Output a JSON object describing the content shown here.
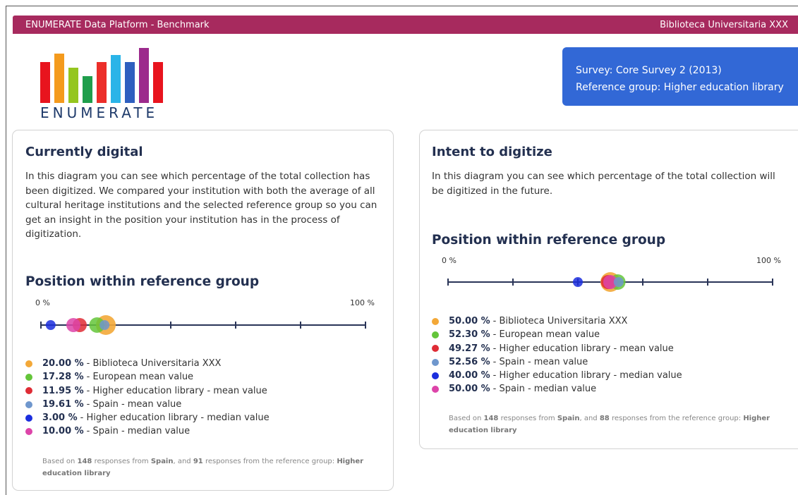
{
  "header": {
    "title": "ENUMERATE Data Platform - Benchmark",
    "institution": "Biblioteca Universitaria XXX"
  },
  "logo": {
    "text": "ENUMERATE",
    "bar_colors": [
      "#e8141e",
      "#f49a1d",
      "#95c61f",
      "#1f9e4c",
      "#ec2e29",
      "#2ab4e8",
      "#2e5fbf",
      "#9c2a8c",
      "#e8141e"
    ]
  },
  "survey": {
    "survey_line": "Survey: Core Survey 2 (2013)",
    "group_line": "Reference group: Higher education library"
  },
  "colors": {
    "institution": "#f3a838",
    "european": "#64c53a",
    "ref_mean": "#df2c35",
    "country_mean": "#6f97cd",
    "ref_median": "#1b2ede",
    "country_median": "#dd44a9"
  },
  "panels": [
    {
      "title": "Currently digital",
      "description": "In this diagram you can see which percentage of the total collection has been digitized. We compared your institution with both the average of all cultural heritage institutions and the selected reference group so you can get an insight in the position your institution has in the process of digitization.",
      "position_title": "Position within reference group",
      "axis_min_label": "0 %",
      "axis_max_label": "100 %",
      "legend": [
        {
          "value": "20.00 %",
          "label": " - Biblioteca Universitaria XXX",
          "pct": 20.0,
          "color_key": "institution"
        },
        {
          "value": "17.28 %",
          "label": " - European mean value",
          "pct": 17.28,
          "color_key": "european"
        },
        {
          "value": "11.95 %",
          "label": " - Higher education library - mean value",
          "pct": 11.95,
          "color_key": "ref_mean"
        },
        {
          "value": "19.61 %",
          "label": " - Spain - mean value",
          "pct": 19.61,
          "color_key": "country_mean"
        },
        {
          "value": "3.00 %",
          "label": " - Higher education library - median value",
          "pct": 3.0,
          "color_key": "ref_median"
        },
        {
          "value": "10.00 %",
          "label": " - Spain - median value",
          "pct": 10.0,
          "color_key": "country_median"
        }
      ],
      "note": {
        "p1": "Based on ",
        "responses": "148",
        "p2": " responses from ",
        "country": "Spain",
        "p3": ", and ",
        "ref_responses": "91",
        "p4": " responses from the reference group: ",
        "group": "Higher education library"
      }
    },
    {
      "title": "Intent to digitize",
      "description": "In this diagram you can see which percentage of the total collection will be digitized in the future.",
      "position_title": "Position within reference group",
      "axis_min_label": "0 %",
      "axis_max_label": "100 %",
      "legend": [
        {
          "value": "50.00 %",
          "label": " - Biblioteca Universitaria XXX",
          "pct": 50.0,
          "color_key": "institution"
        },
        {
          "value": "52.30 %",
          "label": " - European mean value",
          "pct": 52.3,
          "color_key": "european"
        },
        {
          "value": "49.27 %",
          "label": " - Higher education library - mean value",
          "pct": 49.27,
          "color_key": "ref_mean"
        },
        {
          "value": "52.56 %",
          "label": " - Spain - mean value",
          "pct": 52.56,
          "color_key": "country_mean"
        },
        {
          "value": "40.00 %",
          "label": " - Higher education library - median value",
          "pct": 40.0,
          "color_key": "ref_median"
        },
        {
          "value": "50.00 %",
          "label": " - Spain - median value",
          "pct": 50.0,
          "color_key": "country_median"
        }
      ],
      "note": {
        "p1": "Based on ",
        "responses": "148",
        "p2": " responses from ",
        "country": "Spain",
        "p3": ", and ",
        "ref_responses": "88",
        "p4": " responses from the reference group: ",
        "group": "Higher education library"
      }
    }
  ]
}
